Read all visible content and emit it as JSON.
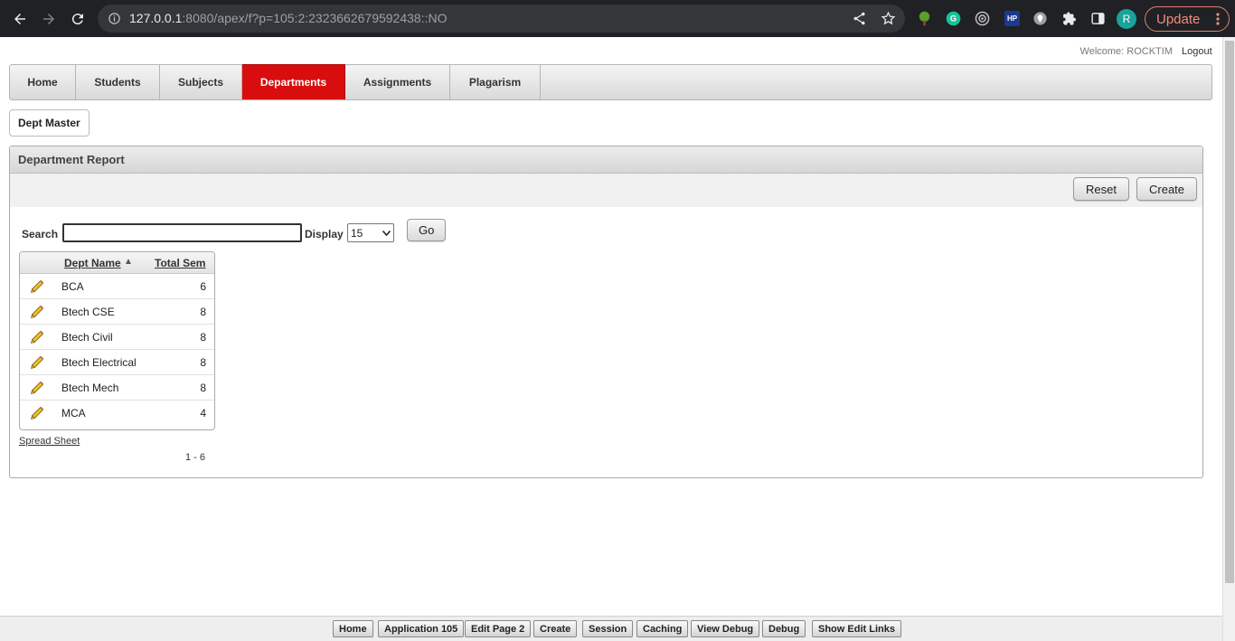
{
  "browser": {
    "url_host": "127.0.0.1",
    "url_rest": ":8080/apex/f?p=105:2:2323662679592438::NO",
    "profile_initial": "R",
    "update_label": "Update",
    "hp_label": "HP"
  },
  "header": {
    "welcome": "Welcome: ROCKTIM",
    "logout": "Logout"
  },
  "tabs": [
    {
      "label": "Home"
    },
    {
      "label": "Students"
    },
    {
      "label": "Subjects"
    },
    {
      "label": "Departments",
      "active": true
    },
    {
      "label": "Assignments"
    },
    {
      "label": "Plagarism"
    }
  ],
  "subtab": {
    "label": "Dept Master"
  },
  "region": {
    "title": "Department Report",
    "reset_label": "Reset",
    "create_label": "Create",
    "search_label": "Search",
    "search_value": "",
    "display_label": "Display",
    "display_value": "15",
    "go_label": "Go"
  },
  "report": {
    "columns": [
      "Dept Name",
      "Total Sem"
    ],
    "sort_indicator": "▲",
    "rows": [
      {
        "name": "BCA",
        "sem": "6"
      },
      {
        "name": "Btech CSE",
        "sem": "8"
      },
      {
        "name": "Btech Civil",
        "sem": "8"
      },
      {
        "name": "Btech Electrical",
        "sem": "8"
      },
      {
        "name": "Btech Mech",
        "sem": "8"
      },
      {
        "name": "MCA",
        "sem": "4"
      }
    ],
    "spreadsheet_label": "Spread Sheet",
    "pagination": "1 - 6"
  },
  "devbar": {
    "home": "Home",
    "application": "Application 105",
    "edit_page": "Edit Page 2",
    "create": "Create",
    "session": "Session",
    "caching": "Caching",
    "view_debug": "View Debug",
    "debug": "Debug",
    "show_edit_links": "Show Edit Links"
  },
  "colors": {
    "active_tab": "#d90d0d",
    "chrome_bg": "#202124"
  }
}
